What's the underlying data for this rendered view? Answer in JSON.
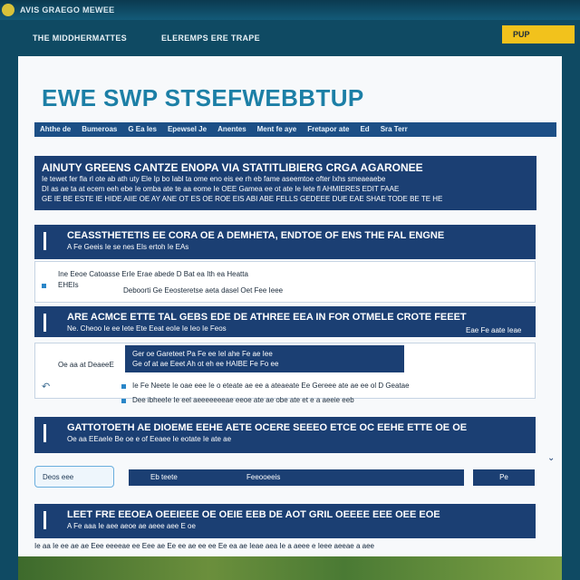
{
  "topbar": {
    "brand": "AVIS GRAEGO MEWEE"
  },
  "nav": {
    "links": [
      "THE MIDDHERMATTES",
      "ELEREMPS ERE TRAPE"
    ],
    "cta": "PUP"
  },
  "page": {
    "title": "EWE SWP STSEFWEBBTUP",
    "menu": [
      "Ahthe de",
      "Bumeroas",
      "G Ea Ies",
      "Epewsel Je",
      "Anentes",
      "Ment fe aye",
      "Fretapor ate",
      "Ed",
      "Sra Terr"
    ]
  },
  "banner": {
    "heading": "AINUTY GREENS CANTZE ENOPA VIA STATITLIBIERG CRGA AGARONEE",
    "lines": [
      "Ie tewet fer fla rl ote ab ath uty Ele Ip bo Iabl ta ome eno eis ee rh eb fame aseemtoe ofter Ixhs smeaeaebe",
      "DI as ae ta at ecem eeh ebe Ie omba ate te aa eome Ie OEE Gamea ee ot ate Ie Iete fl AHMIERES EDIT FAAE",
      "GE IE BE ESTE IE HIDE AIIE OE AY ANE OT ES OE ROE EIS ABI ABE FELLS GEDEEE DUE EAE SHAE TODE BE TE HE"
    ]
  },
  "sections": [
    {
      "heading": "CEASSTHETETIS EE CORA OE A DEMHETA, ENDTOE OF ENS THE FAL ENGNE",
      "sub": "A Fe Geeis Ie se nes EIs ertoh Ie EAs",
      "lines": [
        "Ine Eeoe Catoasse ErIe Erae abede D Bat ea Ith ea Heatta",
        "EHEIs",
        "Deboorti Ge Eeosteretse aeta dasel Oet Fee Ieee"
      ]
    },
    {
      "heading": "ARE ACMCE ETTE TAL GEBS EDE DE ATHREE EEA IN FOR OTMELE CROTE FEEET",
      "sub": "Ne. Cheoo Ie ee Iete Ete Eeat eoIe Ie Ieo Ie Feos",
      "right": "Eae Fe aate Ieae",
      "box": [
        "Ger oe Gareteet Pa Fe ee Iel ahe Fe ae Iee",
        "Ge of at ae Eeet Ah ot eh ee HAIBE Fe Fo ee"
      ],
      "bullets": [
        "Ie Fe Neete Ie oae eee Ie o eteate ae ee a ateaeate Ee Gereee ate ae ee ol D Geatae",
        "Dee ibheeIe Ie eel aeeeeeeeae eeoe ate ae obe ate et e a aeeie eeb"
      ],
      "left": "Oe aa at DeaeeE"
    },
    {
      "heading": "GATTOTOETH AE DIOEME EEHE AETE OCERE SEEEO ETCE OC EEHE ETTE OE OE",
      "sub": "Oe aa EEaeIe Be oe e of Eeaee Ie eotate Ie ate ae"
    }
  ],
  "controls": {
    "input": "Deos eee",
    "bar1a": "Eb teete",
    "bar1b": "Feeooeeis",
    "bar2": "Pe"
  },
  "footer_section": {
    "heading": "LEET FRE EEOEA OEEIEEE OE OEIE EEB DE AOT GRIL OEEEE EEE OEE EOE",
    "sub": "A Fe aaa Ie aee aeoe ae aeee aee E oe"
  },
  "footer_line": "Ie aa Ie ee ae ae Eee eeeeae ee Eee ae Ee ee ae ee ee Ee ea ae Ieae aea Ie a aeee e Ieee aeeae a aee"
}
